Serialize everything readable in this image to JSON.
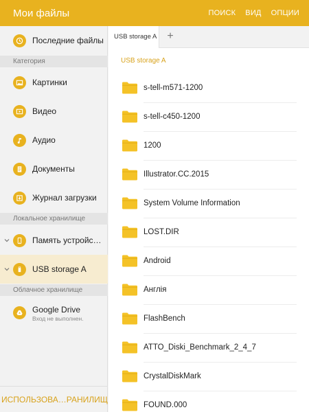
{
  "appbar": {
    "title": "Мои файлы",
    "actions": [
      "ПОИСК",
      "ВИД",
      "ОПЦИИ"
    ],
    "color": "#e8b21f"
  },
  "sidebar": {
    "recent": {
      "label": "Последние файлы",
      "icon": "clock-icon"
    },
    "category_header": "Категория",
    "categories": [
      {
        "label": "Картинки",
        "icon": "image-icon"
      },
      {
        "label": "Видео",
        "icon": "video-icon"
      },
      {
        "label": "Аудио",
        "icon": "music-icon"
      },
      {
        "label": "Документы",
        "icon": "document-icon"
      },
      {
        "label": "Журнал загрузки",
        "icon": "download-icon"
      }
    ],
    "local_header": "Локальное хранилище",
    "local": [
      {
        "label": "Память устройс…",
        "icon": "phone-icon"
      },
      {
        "label": "USB storage A",
        "icon": "usb-icon",
        "active": true
      }
    ],
    "cloud_header": "Облачное хранилище",
    "cloud": {
      "label": "Google Drive",
      "sublabel": "Вход не выполнен.",
      "icon": "google-drive-icon"
    },
    "footer": "ИСПОЛЬЗОВА…РАНИЛИЩА"
  },
  "content": {
    "tab": "USB storage A",
    "path": "USB storage A",
    "files": [
      "s-tell-m571-1200",
      "s-tell-c450-1200",
      "1200",
      "Illustrator.CC.2015",
      "System Volume Information",
      "LOST.DIR",
      "Android",
      "Англія",
      "FlashBench",
      "ATTO_Diski_Benchmark_2_4_7",
      "CrystalDiskMark",
      "FOUND.000"
    ],
    "folder_color": "#f4c227"
  }
}
